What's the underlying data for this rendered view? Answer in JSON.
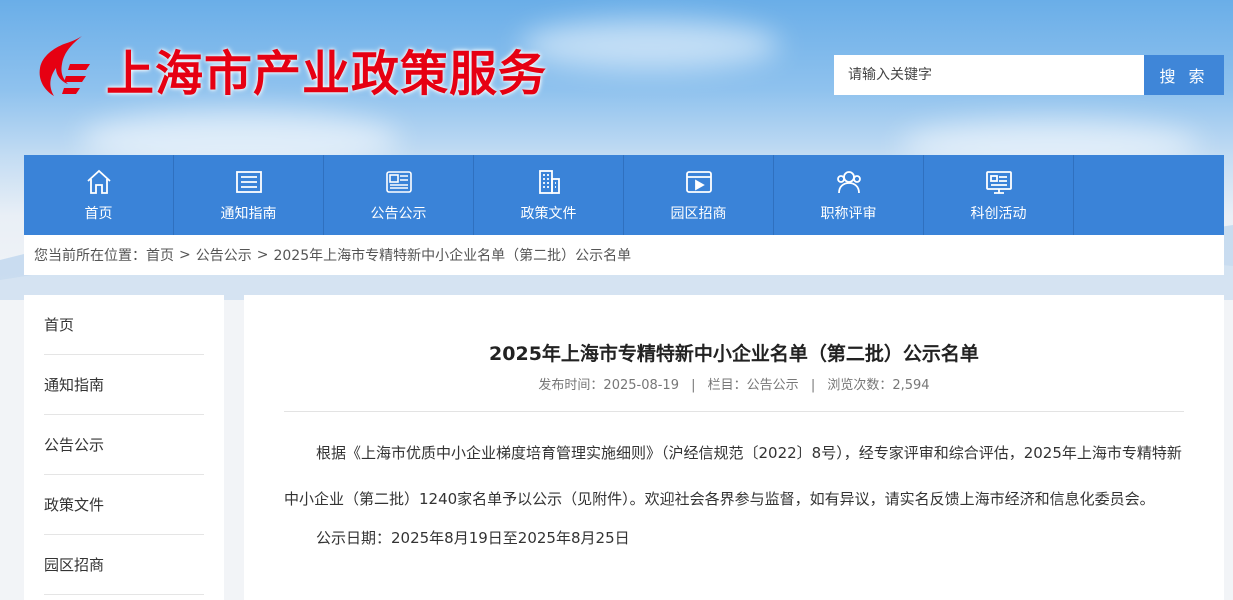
{
  "header": {
    "site_title": "上海市产业政策服务",
    "search_placeholder": "请输入关键字",
    "search_button": "搜 索"
  },
  "nav": {
    "items": [
      {
        "label": "首页",
        "icon": "home-icon"
      },
      {
        "label": "通知指南",
        "icon": "list-icon"
      },
      {
        "label": "公告公示",
        "icon": "news-icon"
      },
      {
        "label": "政策文件",
        "icon": "building-icon"
      },
      {
        "label": "园区招商",
        "icon": "video-icon"
      },
      {
        "label": "职称评审",
        "icon": "users-icon"
      },
      {
        "label": "科创活动",
        "icon": "monitor-icon"
      }
    ]
  },
  "breadcrumb": {
    "prefix": "您当前所在位置：",
    "items": [
      "首页",
      "公告公示",
      "2025年上海市专精特新中小企业名单（第二批）公示名单"
    ],
    "separator": ">"
  },
  "sidebar": {
    "items": [
      "首页",
      "通知指南",
      "公告公示",
      "政策文件",
      "园区招商"
    ]
  },
  "article": {
    "title": "2025年上海市专精特新中小企业名单（第二批）公示名单",
    "publish_time": "发布时间：2025-08-19",
    "column": "栏目：公告公示",
    "views": "浏览次数：2,594",
    "meta_separator": "|",
    "paragraph": "根据《上海市优质中小企业梯度培育管理实施细则》（沪经信规范〔2022〕8号），经专家评审和综合评估，2025年上海市专精特新中小企业（第二批）1240家名单予以公示（见附件）。欢迎社会各界参与监督，如有异议，请实名反馈上海市经济和信息化委员会。",
    "notice_period": "公示日期：2025年8月19日至2025年8月25日"
  },
  "colors": {
    "brand_red": "#e60012",
    "nav_blue": "#3a83d8",
    "search_blue": "#3f86d8"
  }
}
